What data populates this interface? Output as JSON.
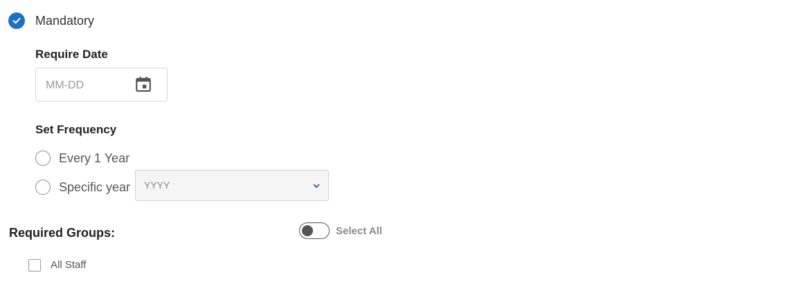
{
  "mandatory": {
    "label": "Mandatory",
    "checked": true
  },
  "require_date": {
    "title": "Require Date",
    "placeholder": "MM-DD",
    "icon": "calendar-icon"
  },
  "frequency": {
    "title": "Set Frequency",
    "options": [
      {
        "label": "Every 1 Year",
        "selected": false
      },
      {
        "label": "Specific year",
        "selected": false
      }
    ],
    "year_select": {
      "placeholder": "YYYY",
      "icon": "chevron-down-icon"
    }
  },
  "groups": {
    "title": "Required Groups:",
    "select_all_label": "Select All",
    "select_all_on": false,
    "items": [
      {
        "label": "All Staff",
        "checked": false
      }
    ]
  },
  "colors": {
    "accent": "#1f6fc5"
  }
}
